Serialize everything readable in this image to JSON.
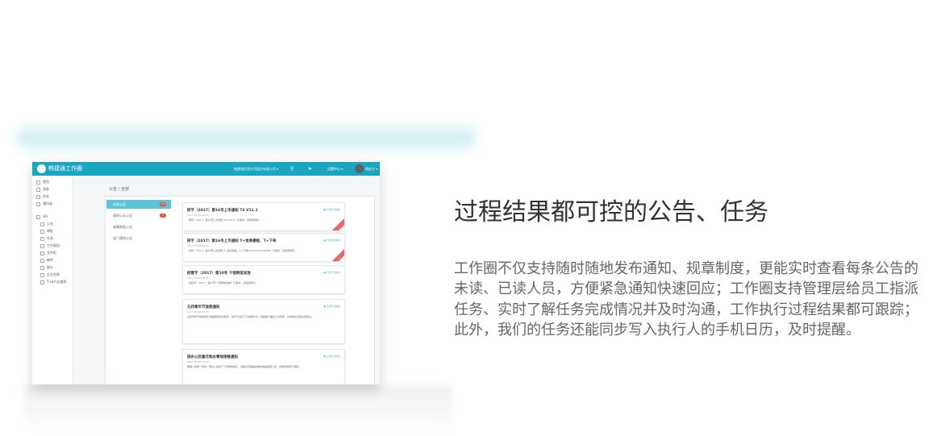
{
  "app": {
    "logo_text": "畅捷通工作圈",
    "top_select": "畅捷通信息技术股份有限公司 ▾",
    "top_icons": [
      "search-icon",
      "send-icon"
    ],
    "user_menu": "设置中心 ▾",
    "user_name": "杨佳宁 ▾"
  },
  "sidebar": {
    "items": [
      {
        "label": "首页",
        "icon": "home-icon"
      },
      {
        "label": "消息",
        "icon": "message-icon"
      },
      {
        "label": "任务",
        "icon": "task-icon"
      },
      {
        "label": "通讯录",
        "icon": "contacts-icon"
      }
    ],
    "section": "OA",
    "sub_items": [
      "公告",
      "审批",
      "任务",
      "工作报告",
      "文件柜",
      "邮件",
      "统计",
      "企业名称",
      "T+S产品使用"
    ]
  },
  "breadcrumb": "公告 / 全部",
  "categories": [
    {
      "label": "全部公告",
      "badge": "123"
    },
    {
      "label": "通知公告公告",
      "badge": "1"
    },
    {
      "label": "规章制度公告",
      "badge": ""
    },
    {
      "label": "部门通知公告",
      "badge": ""
    }
  ],
  "cards": [
    {
      "title": "研字（2017）第16号上市通知 T3 V11.1",
      "date": "2017-05-09 10:02",
      "body": "《研字（2017）第16号上市通知 T3 V11.1》已发布，请查阅附件。",
      "mark": "● 全部已读确认"
    },
    {
      "title": "研字（2017）第16号上市通知 T+金表模板、T+下单",
      "date": "2017-05-09 09:40",
      "body": "《研字（2017）第16号上市通知 T+金表模板、T+下单V12.200.001.0040》已发布，请查阅附件。",
      "mark": "● 全部已读确认"
    },
    {
      "title": "经营字（2017）第10号 千锁网信发放",
      "date": "2017-05-08 16:20",
      "body": "《经营字（2017）第10号 千锁网信发放》已发布，请查阅附件。",
      "mark": "● 全部已读确认"
    },
    {
      "title": "五四青年节放假通知",
      "date": "2017-05-02 09:32",
      "body": "五四青年节放假通知 根据国家有关规定，青年节当天下午放假半天，请各部门做好工作安排，并请相关同事注意安全。",
      "mark": "● 全部已读确认"
    },
    {
      "title": "部办公区搬迁和办事地接替通知",
      "date": "2017-04-28 14:12",
      "body": "根据公司统一安排，部办公区将于下周整体搬迁，请各位同事提前做好物品整理工作，具体安排另行通知。",
      "mark": "● 全部已读确认"
    }
  ],
  "headline": "过程结果都可控的公告、任务",
  "paragraph": "工作圈不仅支持随时随地发布通知、规章制度，更能实时查看每条公告的未读、已读人员，方便紧急通知快速回应；工作圈支持管理层给员工指派任务、实时了解任务完成情况并及时沟通，工作执行过程结果都可跟踪；此外，我们的任务还能同步写入执行人的手机日历，及时提醒。"
}
